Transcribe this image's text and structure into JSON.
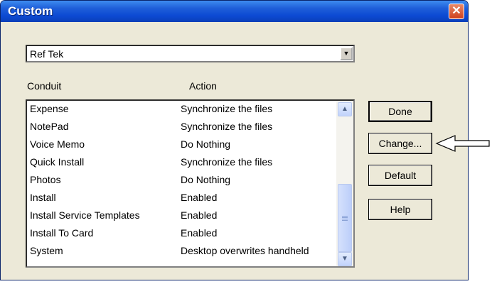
{
  "window": {
    "title": "Custom",
    "close_glyph": "✕"
  },
  "combo": {
    "value": "Ref Tek"
  },
  "columns": {
    "conduit": "Conduit",
    "action": "Action"
  },
  "rows": [
    {
      "conduit": "Expense",
      "action": "Synchronize the files"
    },
    {
      "conduit": "NotePad",
      "action": "Synchronize the files"
    },
    {
      "conduit": "Voice Memo",
      "action": "Do Nothing"
    },
    {
      "conduit": "Quick Install",
      "action": "Synchronize the files"
    },
    {
      "conduit": "Photos",
      "action": "Do Nothing"
    },
    {
      "conduit": "Install",
      "action": "Enabled"
    },
    {
      "conduit": "Install Service Templates",
      "action": "Enabled"
    },
    {
      "conduit": "Install To Card",
      "action": "Enabled"
    },
    {
      "conduit": "System",
      "action": "Desktop overwrites handheld"
    }
  ],
  "buttons": {
    "done": "Done",
    "change": "Change...",
    "default": "Default",
    "help": "Help"
  },
  "icons": {
    "scroll_up": "▲",
    "scroll_down": "▼",
    "dropdown": "▼"
  }
}
